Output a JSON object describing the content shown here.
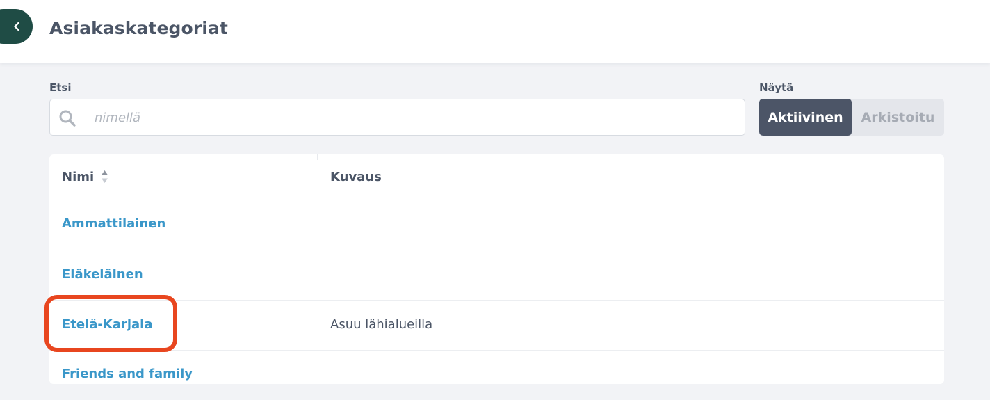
{
  "header": {
    "title": "Asiakaskategoriat"
  },
  "search": {
    "label": "Etsi",
    "placeholder": "nimellä",
    "value": ""
  },
  "filter": {
    "label": "Näytä",
    "options": [
      "Aktiivinen",
      "Arkistoitu"
    ],
    "selected": "Aktiivinen"
  },
  "table": {
    "columns": [
      "Nimi",
      "Kuvaus"
    ],
    "sorted_column": "Nimi",
    "rows": [
      {
        "name": "Ammattilainen",
        "description": ""
      },
      {
        "name": "Eläkeläinen",
        "description": ""
      },
      {
        "name": "Etelä-Karjala",
        "description": "Asuu lähialueilla"
      },
      {
        "name": "Friends and family",
        "description": ""
      }
    ]
  },
  "colors": {
    "accent": "#1f4c45",
    "link": "#3a97c9",
    "active_toggle": "#4c5567",
    "highlight": "#e8461f"
  }
}
